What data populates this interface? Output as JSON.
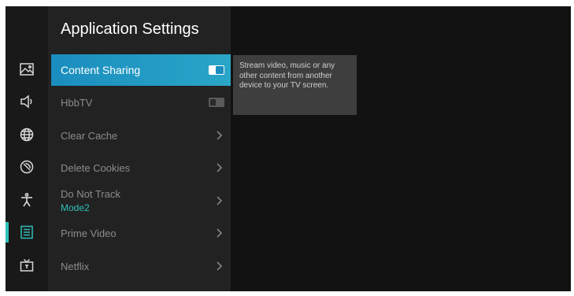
{
  "app": {
    "title": "Application Settings"
  },
  "sidebar": {
    "items": [
      {
        "icon": "picture-icon",
        "active": false
      },
      {
        "icon": "sound-icon",
        "active": false
      },
      {
        "icon": "network-icon",
        "active": false
      },
      {
        "icon": "channels-icon",
        "active": false
      },
      {
        "icon": "accessibility-icon",
        "active": false
      },
      {
        "icon": "applications-icon",
        "active": true
      },
      {
        "icon": "tv-icon",
        "active": false
      }
    ]
  },
  "menu": {
    "items": [
      {
        "label": "Content Sharing",
        "control": "toggle",
        "state": "on",
        "selected": true
      },
      {
        "label": "HbbTV",
        "control": "toggle",
        "state": "off",
        "selected": false
      },
      {
        "label": "Clear Cache",
        "control": "chevron",
        "selected": false
      },
      {
        "label": "Delete Cookies",
        "control": "chevron",
        "selected": false
      },
      {
        "label": "Do Not Track",
        "sublabel": "Mode2",
        "control": "chevron",
        "selected": false
      },
      {
        "label": "Prime Video",
        "control": "chevron",
        "selected": false
      },
      {
        "label": "Netflix",
        "control": "chevron",
        "selected": false
      }
    ]
  },
  "tooltip": {
    "text": "Stream video, music or any other content from another device to your TV screen."
  },
  "colors": {
    "accent": "#2ec0b8",
    "selection": "#1a8dbe",
    "panel": "#222222",
    "background": "#121212"
  }
}
